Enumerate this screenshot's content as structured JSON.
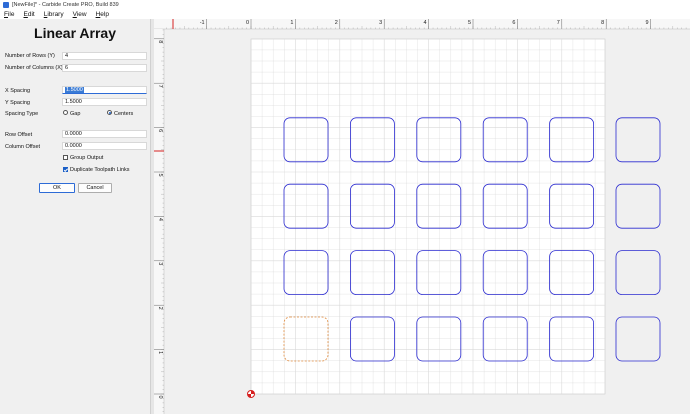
{
  "window": {
    "title": "[NewFile]* - Carbide Create PRO, Build 839"
  },
  "menu": {
    "items": [
      {
        "key": "F",
        "rest": "ile"
      },
      {
        "key": "E",
        "rest": "dit"
      },
      {
        "key": "L",
        "rest": "ibrary"
      },
      {
        "key": "V",
        "rest": "iew"
      },
      {
        "key": "H",
        "rest": "elp"
      }
    ]
  },
  "panel": {
    "title": "Linear Array",
    "rows_label": "Number of Rows (Y)",
    "rows_value": "4",
    "cols_label": "Number of Columns (X)",
    "cols_value": "6",
    "x_spacing_label": "X Spacing",
    "x_spacing_value": "1.5000",
    "y_spacing_label": "Y Spacing",
    "y_spacing_value": "1.5000",
    "spacing_type_label": "Spacing Type",
    "gap_label": "Gap",
    "centers_label": "Centers",
    "spacing_type_selected": "Centers",
    "row_offset_label": "Row Offset",
    "row_offset_value": "0.0000",
    "col_offset_label": "Column Offset",
    "col_offset_value": "0.0000",
    "group_output_label": "Group Output",
    "group_output_checked": false,
    "dup_links_label": "Duplicate Toolpath Links",
    "dup_links_checked": true,
    "ok_label": "OK",
    "cancel_label": "Cancel"
  },
  "canvas": {
    "ruler_x_labels": [
      "-1",
      "0",
      "1",
      "2",
      "3",
      "4",
      "5",
      "6",
      "7",
      "8",
      "9"
    ],
    "ruler_y_labels": [
      "8",
      "7",
      "6",
      "5",
      "4",
      "3",
      "2",
      "1",
      "0"
    ],
    "array_rows": 4,
    "array_cols": 6,
    "shape_color": "#2b2bd0",
    "original_color": "#e08a3c",
    "origin_icon": "origin-marker-icon"
  },
  "colors": {
    "ruler_marker": "#d62020",
    "grid_line": "#d9d9d9",
    "selection_highlight": "#3a7bd5"
  }
}
